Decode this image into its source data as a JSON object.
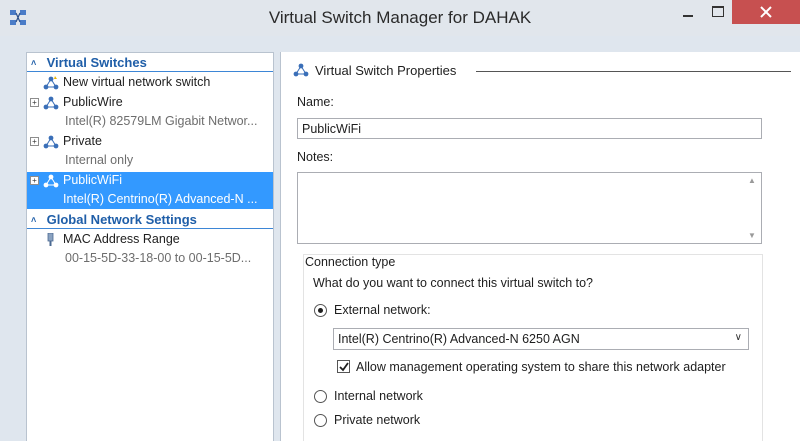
{
  "window": {
    "title": "Virtual Switch Manager for DAHAK"
  },
  "left_pane": {
    "virtual_switches_header": "Virtual Switches",
    "items": [
      {
        "label": "New virtual network switch",
        "sub": "",
        "icon": "new-switch-icon"
      },
      {
        "label": "PublicWire",
        "sub": "Intel(R) 82579LM Gigabit Networ...",
        "icon": "network-switch-icon"
      },
      {
        "label": "Private",
        "sub": "Internal only",
        "icon": "network-switch-icon"
      },
      {
        "label": "PublicWiFi",
        "sub": "Intel(R) Centrino(R) Advanced-N ...",
        "icon": "network-switch-icon",
        "selected": true
      }
    ],
    "global_header": "Global Network Settings",
    "global_items": [
      {
        "label": "MAC Address Range",
        "sub": "00-15-5D-33-18-00 to 00-15-5D...",
        "icon": "mac-address-icon"
      }
    ]
  },
  "right_pane": {
    "section_title": "Virtual Switch Properties",
    "name_label": "Name:",
    "name_value": "PublicWiFi",
    "notes_label": "Notes:",
    "notes_value": "",
    "connection_type_label": "Connection type",
    "connection_question": "What do you want to connect this virtual switch to?",
    "external_label": "External network:",
    "external_adapter": "Intel(R) Centrino(R) Advanced-N 6250 AGN",
    "allow_mgmt_label": "Allow management operating system to share this network adapter",
    "internal_label": "Internal network",
    "private_label": "Private network"
  },
  "colors": {
    "selection": "#3399ff",
    "header_text": "#1f5ea8",
    "close_button": "#c75050"
  }
}
